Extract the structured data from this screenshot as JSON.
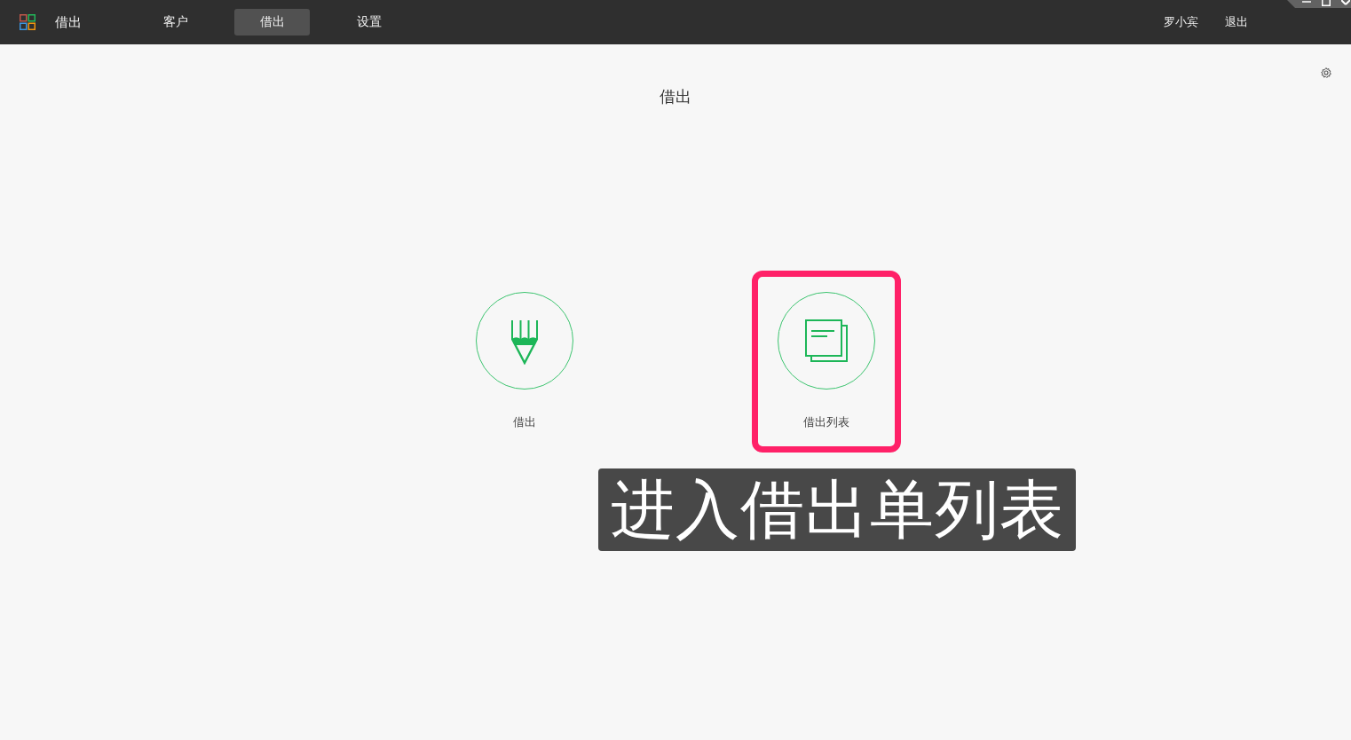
{
  "top_bar": {
    "app_title": "借出",
    "nav": [
      {
        "label": "客户",
        "selected": false
      },
      {
        "label": "借出",
        "selected": true
      },
      {
        "label": "设置",
        "selected": false
      }
    ],
    "user": "罗小宾",
    "logout": "退出"
  },
  "page": {
    "title": "借出",
    "tiles": [
      {
        "label": "借出",
        "kind": "pencil",
        "highlighted": false
      },
      {
        "label": "借出列表",
        "kind": "list",
        "highlighted": true
      }
    ]
  },
  "annotation": {
    "caption": "进入借出单列表"
  }
}
